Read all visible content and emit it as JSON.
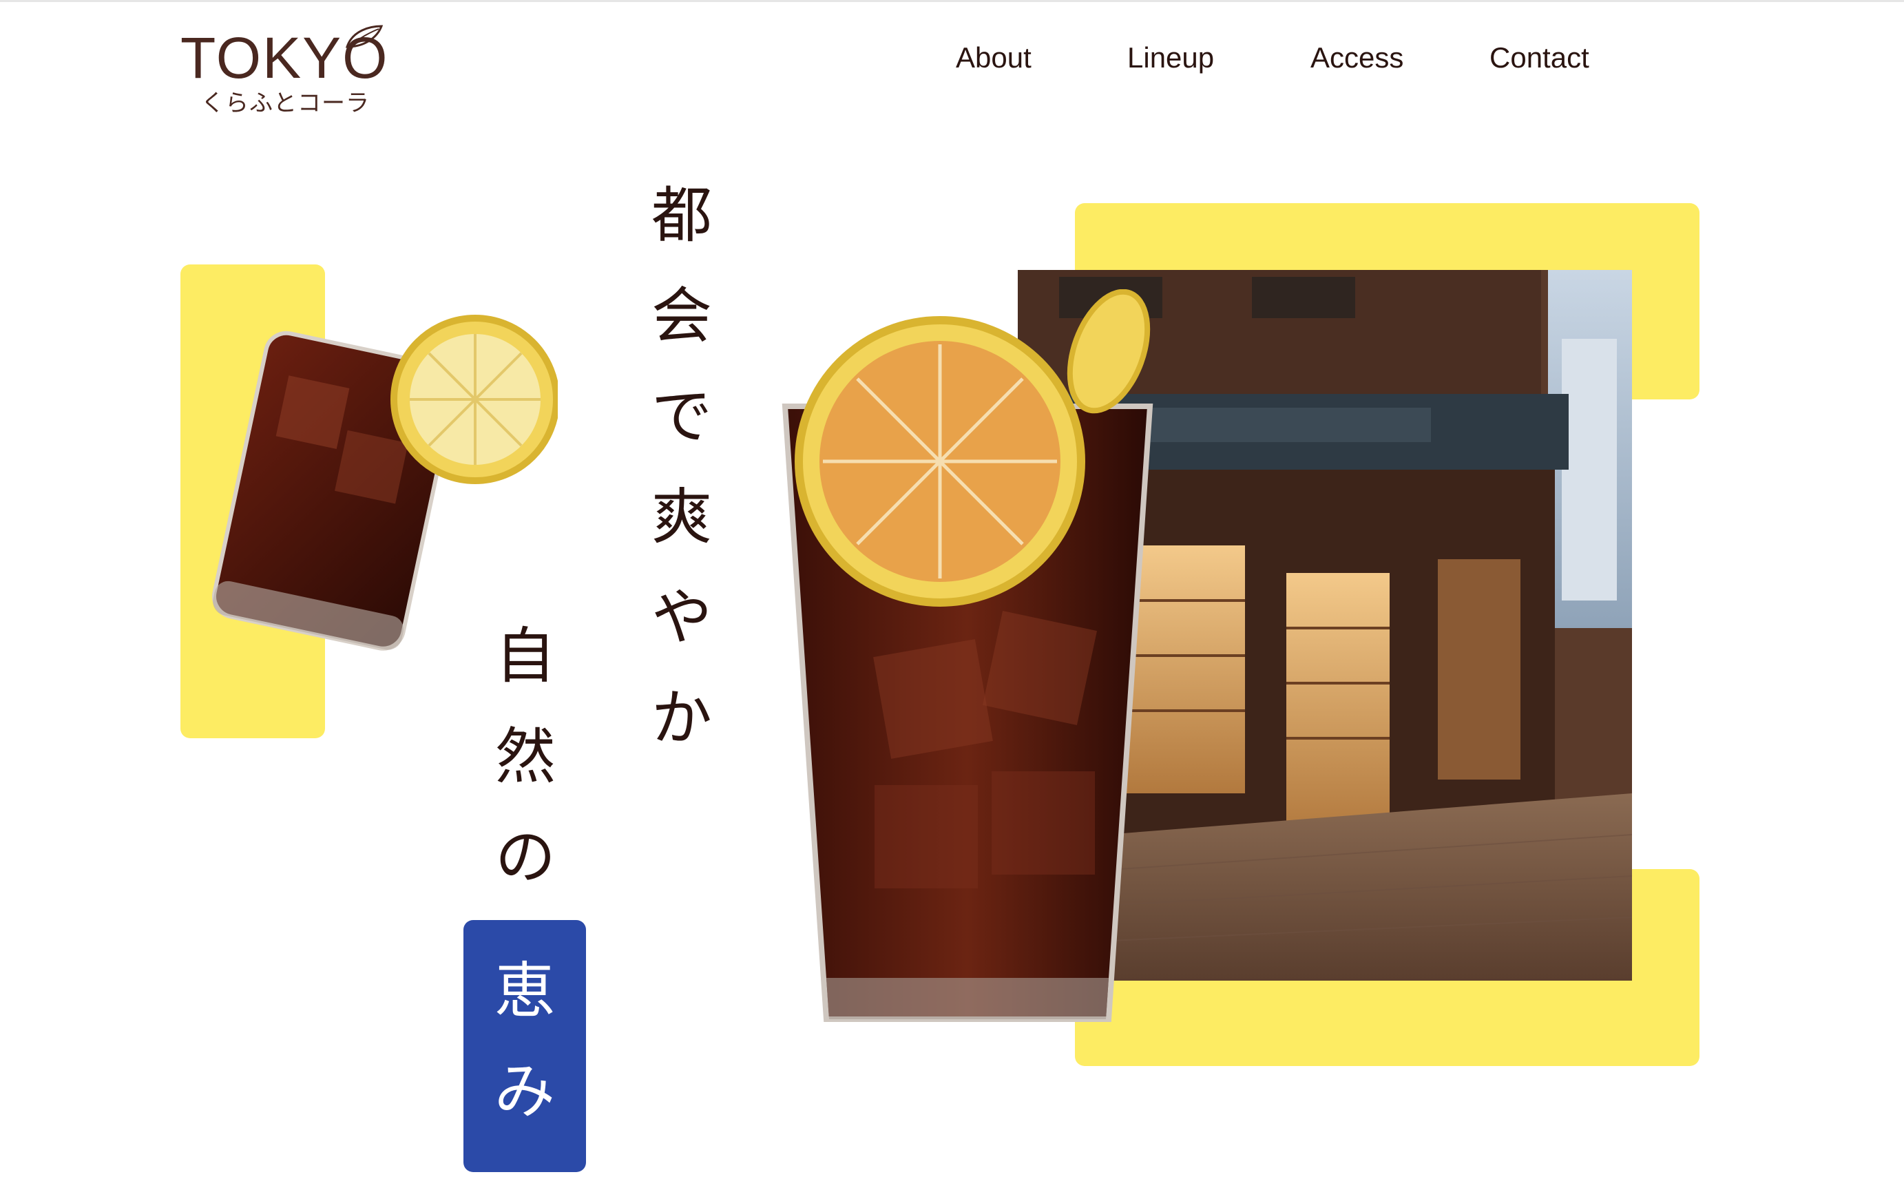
{
  "header": {
    "logo": {
      "word": "TOKYO",
      "subtitle": "くらふとコーラ"
    },
    "nav": [
      {
        "label": "About"
      },
      {
        "label": "Lineup"
      },
      {
        "label": "Access"
      },
      {
        "label": "Contact"
      }
    ]
  },
  "hero": {
    "tagline_1": [
      "都",
      "会",
      "で",
      "爽",
      "や",
      "か"
    ],
    "tagline_2": [
      "自",
      "然",
      "の"
    ],
    "tagline_highlight": [
      "恵",
      "み"
    ]
  },
  "colors": {
    "accent_yellow": "#fdec63",
    "accent_blue": "#2b4aa8",
    "text_brown": "#2a1410"
  },
  "images": {
    "small_glass": "iced-cola-glass-with-lemon",
    "large_glass": "tall-iced-cola-glass-with-lemon",
    "storefront": "shop-storefront-photo"
  }
}
